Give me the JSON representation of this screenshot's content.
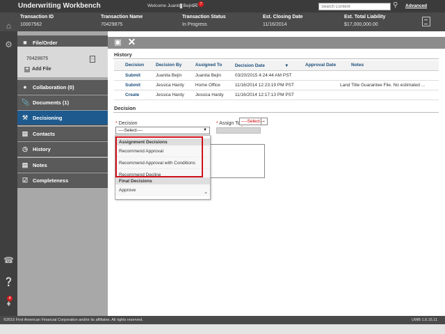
{
  "app": {
    "title": "Underwriting Workbench",
    "welcome": "Welcome Juanita Bejin",
    "mail_badge": "7",
    "search_placeholder": "Search Content",
    "advanced": "Advanced"
  },
  "header": {
    "transaction_id_label": "Transaction ID",
    "transaction_id": "10007562",
    "transaction_name_label": "Transaction Name",
    "transaction_name": "70429875",
    "transaction_status_label": "Transaction Status",
    "transaction_status": "In Progress",
    "closing_date_label": "Est. Closing Date",
    "closing_date": "11/16/2014",
    "liability_label": "Est. Total Liability",
    "liability": "$17,000,000.00"
  },
  "rail": {
    "alert_badge": "4"
  },
  "sidenav": {
    "file_order": "File/Order",
    "file_id": "70429875",
    "add_file": "Add File",
    "collaboration": "Collaboration (0)",
    "documents": "Documents (1)",
    "decisioning": "Decisioning",
    "contacts": "Contacts",
    "history": "History",
    "notes": "Notes",
    "completeness": "Completeness"
  },
  "history": {
    "title": "History",
    "columns": [
      "Decision",
      "Decision By",
      "Assigned To",
      "Decision Date",
      "Approval Date",
      "Notes"
    ],
    "rows": [
      [
        "Submit",
        "Juanita Bejin",
        "Juanita Bejin",
        "03/20/2015 4:24:44 AM PST",
        "",
        ""
      ],
      [
        "Submit",
        "Jessica Hardy",
        "Home Office",
        "11/16/2014 12:23:19 PM PST",
        "",
        "Land Title Guarantee File. No estimated ..."
      ],
      [
        "Create",
        "Jessica Hardy",
        "Jessica Hardy",
        "11/16/2014 12:17:13 PM PST",
        "",
        ""
      ]
    ]
  },
  "decision": {
    "title": "Decision",
    "required_mark": "*",
    "decision_label": "Decision",
    "decision_value": "----Select----",
    "assign_label": "Assign To:",
    "assign_value": "----Select----"
  },
  "dropdown": {
    "group1": "Assignment Decisions",
    "item1": "Recommend Approval",
    "item2": "Recommend Approval with Conditions",
    "item3": "Recommend Decline",
    "group2": "Final Decisions",
    "item4": "Approve"
  },
  "footer": {
    "copyright": "©2015 First American Financial Corporation and/or its affiliates. All rights reserved.",
    "version": "UWB 1.0.15.11"
  },
  "colors": {
    "active_nav": "#1e5a8e",
    "highlight": "#d0101a",
    "badge": "#d51e1e"
  }
}
